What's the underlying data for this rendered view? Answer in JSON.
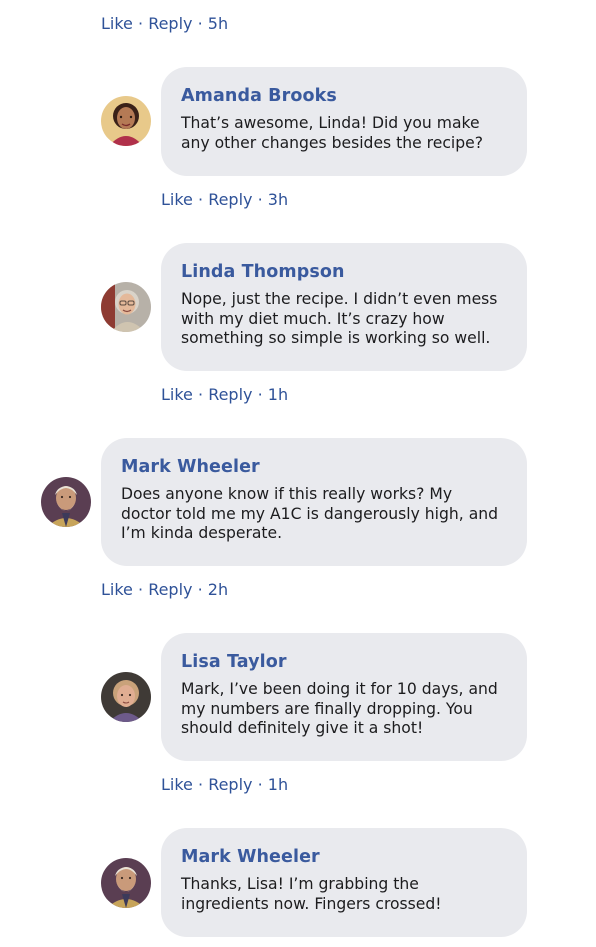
{
  "top_actions": {
    "like": "Like",
    "reply": "Reply",
    "time": "5h"
  },
  "comments": [
    {
      "author": "Amanda Brooks",
      "text": "That’s awesome, Linda! Did you make any other changes besides the recipe?",
      "like": "Like",
      "reply": "Reply",
      "time": "3h",
      "avatar_icon": "amanda-avatar"
    },
    {
      "author": "Linda Thompson",
      "text": "Nope, just the recipe. I didn’t even mess with my diet much. It’s crazy how something so simple is working so well.",
      "like": "Like",
      "reply": "Reply",
      "time": "1h",
      "avatar_icon": "linda-avatar"
    },
    {
      "author": "Mark Wheeler",
      "text": "Does anyone know if this really works? My doctor told me my A1C is dangerously high, and I’m kinda desperate.",
      "like": "Like",
      "reply": "Reply",
      "time": "2h",
      "avatar_icon": "mark-avatar"
    },
    {
      "author": "Lisa Taylor",
      "text": "Mark, I’ve been doing it for 10 days, and my numbers are finally dropping. You should definitely give it a shot!",
      "like": "Like",
      "reply": "Reply",
      "time": "1h",
      "avatar_icon": "lisa-avatar"
    },
    {
      "author": "Mark Wheeler",
      "text": "Thanks, Lisa! I’m grabbing the ingredients now. Fingers crossed!",
      "avatar_icon": "mark-avatar"
    }
  ],
  "colors": {
    "link": "#2f5298",
    "author": "#3a5a9e",
    "bubble": "#e9eaee",
    "text": "#1c1c1e"
  }
}
